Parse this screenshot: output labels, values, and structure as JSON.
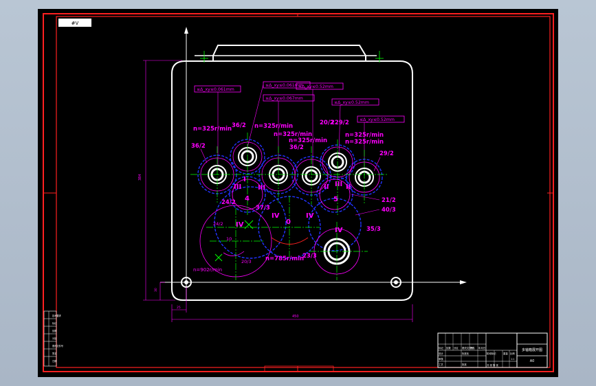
{
  "drawing": {
    "top_left_label": "#V",
    "height_dim": "384",
    "width_dim": "450",
    "offset_dim_x": "25",
    "offset_dim_y": "30",
    "sheet_title": "多轴箱展开图",
    "sheet_code": "A0"
  },
  "tolerances": [
    "≤Δ_xy≤0.061mm",
    "≤Δ_xy≤0.061mm",
    "≤Δ_xy≤0.067mm",
    "≤Δ_xy≤0.52mm",
    "≤Δ_xy≤0.52mm",
    "≤Δ_xy≤0.52mm"
  ],
  "speeds": {
    "s1": "n=325r/min",
    "s2": "n=325r/min",
    "s3": "n=325r/min",
    "s4": "n=325r/min",
    "s5": "n=325r/min",
    "s6": "n=325r/min",
    "s7": "n=785r/min",
    "s8": "n=902r/min"
  },
  "gear_labels": {
    "g1": "36/2",
    "g2": "36/2",
    "g3": "36/2",
    "g4": "20/2",
    "g5": "229/2",
    "g6": "29/2",
    "g7": "24/2",
    "g8": "37/3",
    "g9": "21/2",
    "g10": "40/3",
    "g11": "35/3",
    "g12": "23/3",
    "g13": "24/2",
    "g14": "20/3",
    "g15": "10"
  },
  "shaft_labels": {
    "a": "I",
    "b": "III",
    "c": "III",
    "d": "II",
    "e": "III",
    "f": "II",
    "g": "4",
    "h": "5",
    "i": "IV",
    "j": "IV",
    "k": "IV",
    "l": "IV",
    "m": "0"
  },
  "left_panel": [
    "技术要求",
    "标记",
    "处数",
    "分区",
    "更改文件号",
    "签名",
    "日期"
  ],
  "title_block": {
    "r1": [
      "标记",
      "处数",
      "分区",
      "更改文件号",
      "签名",
      "年月日"
    ],
    "r2": [
      "设计",
      "",
      "",
      "标准化",
      "",
      ""
    ],
    "r3": [
      "审核",
      "",
      "",
      "",
      "",
      ""
    ],
    "r4": [
      "工艺",
      "",
      "批准",
      "",
      "",
      ""
    ],
    "stage": "阶段标记",
    "weight": "重量",
    "scale": "比例",
    "scale_val": "1:1",
    "sheets": "共 张 第 张"
  },
  "colors": {
    "frame": "#ff0000",
    "outline": "#ffffff",
    "dims": "#ff00ff",
    "center": "#00ff00",
    "pitch": "#0000ff"
  }
}
